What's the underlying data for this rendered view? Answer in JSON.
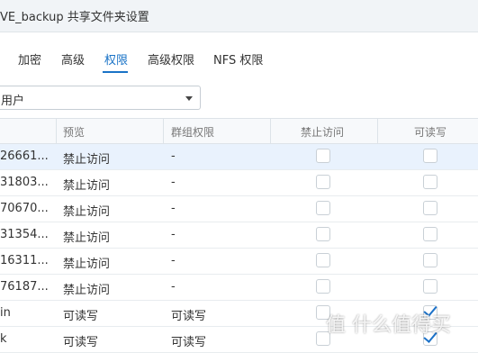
{
  "window": {
    "title": "VE_backup 共享文件夹设置"
  },
  "tabs": [
    {
      "label": "加密",
      "active": false
    },
    {
      "label": "高级",
      "active": false
    },
    {
      "label": "权限",
      "active": true
    },
    {
      "label": "高级权限",
      "active": false
    },
    {
      "label": "NFS 权限",
      "active": false
    }
  ],
  "user_filter": {
    "value": "用户"
  },
  "table": {
    "headers": [
      "预览",
      "群组权限",
      "禁止访问",
      "可读写"
    ],
    "rows": [
      {
        "name": "26661...",
        "preview": "禁止访问",
        "group": "-",
        "deny": false,
        "rw": false,
        "selected": true
      },
      {
        "name": "31803...",
        "preview": "禁止访问",
        "group": "-",
        "deny": false,
        "rw": false,
        "selected": false
      },
      {
        "name": "70670...",
        "preview": "禁止访问",
        "group": "-",
        "deny": false,
        "rw": false,
        "selected": false
      },
      {
        "name": "31354...",
        "preview": "禁止访问",
        "group": "-",
        "deny": false,
        "rw": false,
        "selected": false
      },
      {
        "name": "16311...",
        "preview": "禁止访问",
        "group": "-",
        "deny": false,
        "rw": false,
        "selected": false
      },
      {
        "name": "76187...",
        "preview": "禁止访问",
        "group": "-",
        "deny": false,
        "rw": false,
        "selected": false
      },
      {
        "name": "in",
        "preview": "可读写",
        "group": "可读写",
        "deny": false,
        "rw": true,
        "selected": false
      },
      {
        "name": "k",
        "preview": "可读写",
        "group": "可读写",
        "deny": false,
        "rw": true,
        "selected": false
      }
    ]
  },
  "watermark": {
    "text": "值 什么值得买"
  },
  "colors": {
    "accent": "#1a73c7",
    "deny": "#b23a3a",
    "readwrite": "#d0810d",
    "selected_row": "#e9f2fd"
  }
}
